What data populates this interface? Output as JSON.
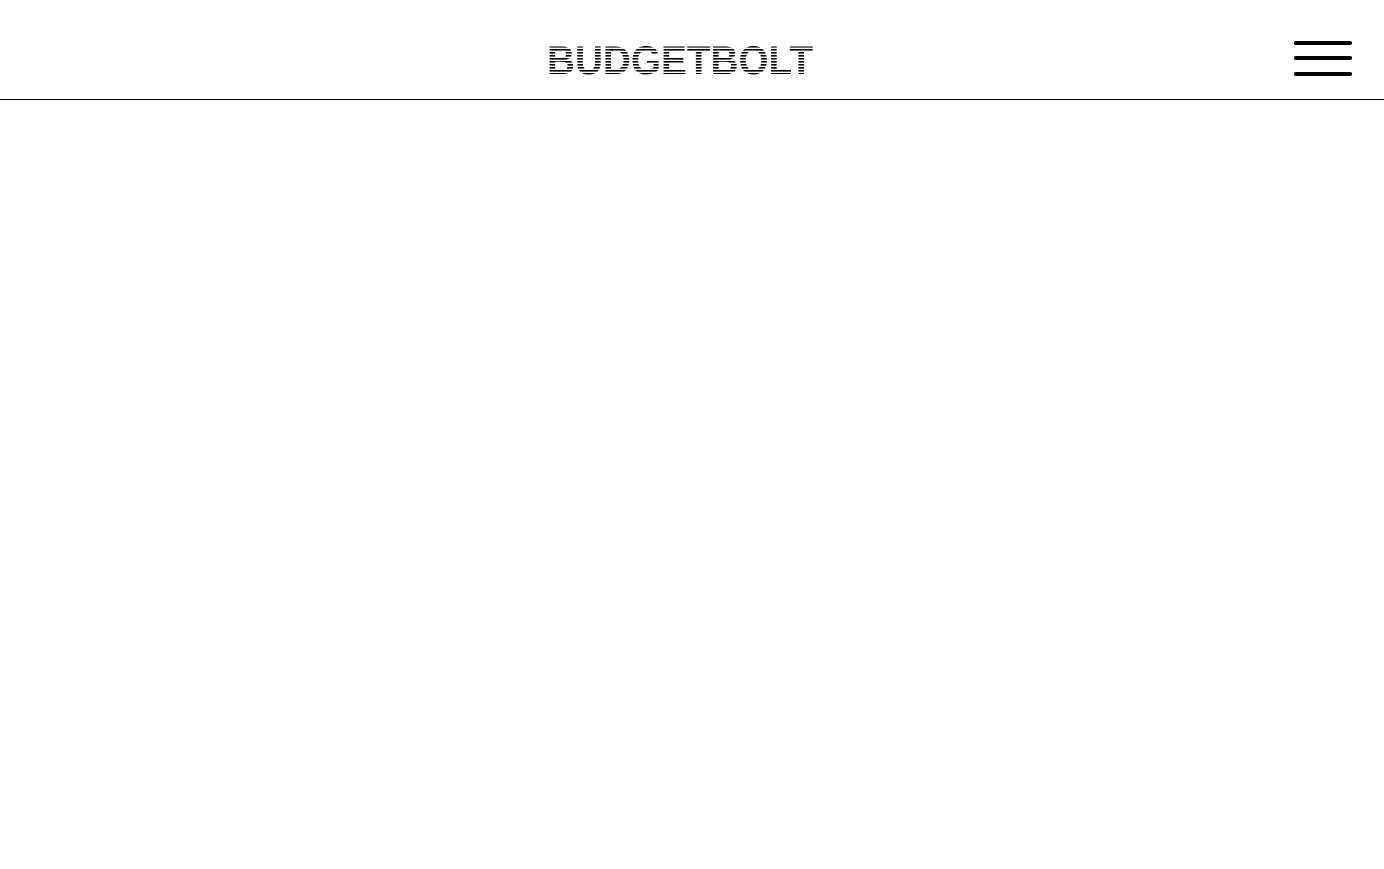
{
  "header": {
    "brand": {
      "text": "BUDGETBOLT",
      "style": "striped-wordmark",
      "color": "#000000"
    },
    "menu_button": {
      "icon": "hamburger-menu-icon"
    }
  },
  "main": {
    "content": ""
  },
  "colors": {
    "background": "#ffffff",
    "foreground": "#000000",
    "divider": "#000000"
  }
}
